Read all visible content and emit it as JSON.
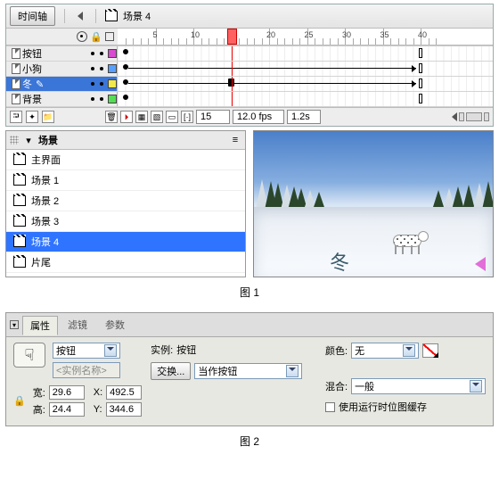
{
  "fig1_caption": "图 1",
  "fig2_caption": "图 2",
  "timeline": {
    "button_label": "时间轴",
    "scene_label": "场景 4",
    "ruler": {
      "start": 1,
      "end": 40,
      "major_every": 5
    },
    "playhead_frame": 15,
    "layers": [
      {
        "name": "按钮",
        "color": "#d94bcf",
        "selected": false,
        "kf_start": 1,
        "kf_end": 40,
        "tween": false
      },
      {
        "name": "小狗",
        "color": "#58a0ff",
        "selected": false,
        "kf_start": 1,
        "kf_end": 40,
        "tween": true
      },
      {
        "name": "冬",
        "color": "#f2e84a",
        "selected": true,
        "kf_start": 1,
        "kf_end": 40,
        "tween": true,
        "midkf": 15,
        "pencil": true
      },
      {
        "name": "背景",
        "color": "#55dd55",
        "selected": false,
        "kf_start": 1,
        "kf_end": 40,
        "tween": false
      }
    ],
    "status": {
      "frame": "15",
      "fps": "12.0 fps",
      "time": "1.2s"
    }
  },
  "scenes": {
    "header": "场景",
    "items": [
      {
        "label": "主界面",
        "selected": false
      },
      {
        "label": "场景 1",
        "selected": false
      },
      {
        "label": "场景 2",
        "selected": false
      },
      {
        "label": "场景 3",
        "selected": false
      },
      {
        "label": "场景 4",
        "selected": true
      },
      {
        "label": "片尾",
        "selected": false
      }
    ]
  },
  "preview": {
    "glyph": "冬"
  },
  "props": {
    "tabs": {
      "properties": "属性",
      "filters": "滤镜",
      "params": "参数"
    },
    "type": "按钮",
    "instance_placeholder": "<实例名称>",
    "instance_lbl": "实例:",
    "instance_val": "按钮",
    "swap_btn": "交换...",
    "behavior": "当作按钮",
    "color_lbl": "颜色:",
    "color_val": "无",
    "blend_lbl": "混合:",
    "blend_val": "一般",
    "cache_lbl": "使用运行时位图缓存",
    "w_lbl": "宽:",
    "w_val": "29.6",
    "h_lbl": "高:",
    "h_val": "24.4",
    "x_lbl": "X:",
    "x_val": "492.5",
    "y_lbl": "Y:",
    "y_val": "344.6"
  }
}
